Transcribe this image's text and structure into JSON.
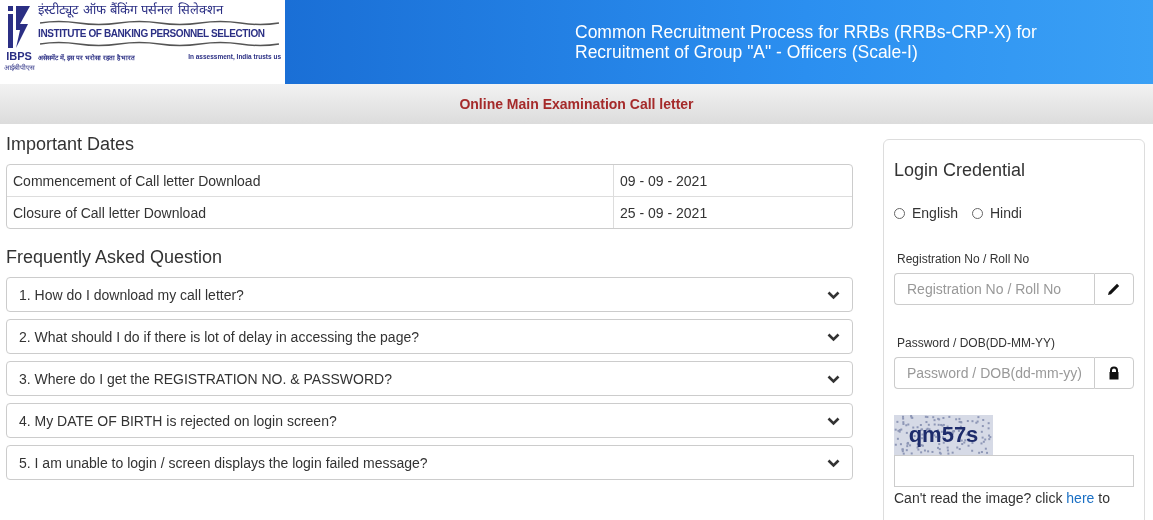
{
  "logo": {
    "hindi_name": "इंस्टीट्यूट ऑफ बैंकिंग पर्सनल सिलेक्शन",
    "english_name": "INSTITUTE OF BANKING PERSONNEL SELECTION",
    "mark": "IBPS",
    "mark_hindi": "आईबीपीएस",
    "tagline_hindi": "असेसमेंट में, इस पर भरोसा रहता है भारत",
    "tagline": "In assessment, India trusts us"
  },
  "header": {
    "title": "Common Recruitment Process for RRBs (RRBs-CRP-X) for Recruitment of Group \"A\" - Officers (Scale-I)"
  },
  "subheader": "Online Main Examination Call letter",
  "important_dates": {
    "heading": "Important Dates",
    "rows": [
      {
        "label": "Commencement of Call letter Download",
        "date": "09 - 09 - 2021"
      },
      {
        "label": "Closure of Call letter Download",
        "date": "25 - 09 - 2021"
      }
    ]
  },
  "faq": {
    "heading": "Frequently Asked Question",
    "items": [
      {
        "question": "1. How do I download my call letter?",
        "expanded": false
      },
      {
        "question": "2. What should I do if there is lot of delay in accessing the page?",
        "expanded": false
      },
      {
        "question": "3. Where do I get the REGISTRATION NO. & PASSWORD?",
        "expanded": false
      },
      {
        "question": "4. My DATE OF BIRTH is rejected on login screen?",
        "expanded": false
      },
      {
        "question": "5. I am unable to login / screen displays the login failed message?",
        "expanded": false
      }
    ]
  },
  "login": {
    "title": "Login Credential",
    "languages": [
      {
        "label": "English",
        "selected": false
      },
      {
        "label": "Hindi",
        "selected": false
      }
    ],
    "fields": [
      {
        "label": "Registration No / Roll No",
        "placeholder": "Registration No / Roll No",
        "kind": "pencil"
      },
      {
        "label": "Password / DOB(DD-MM-YY)",
        "placeholder": "Password / DOB(dd-mm-yy)",
        "kind": "lock"
      }
    ],
    "captcha": "qm57s",
    "refresh_text": "Can't read the image? click ",
    "refresh_link": "here",
    "refresh_after": " to"
  }
}
